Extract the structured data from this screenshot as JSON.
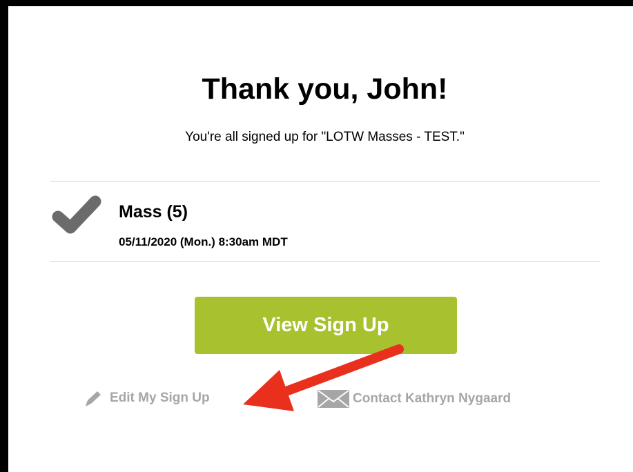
{
  "confirmation": {
    "title": "Thank you, John!",
    "subtitle": "You're all signed up for \"LOTW Masses - TEST.\""
  },
  "slot": {
    "title": "Mass (5)",
    "datetime": "05/11/2020 (Mon.) 8:30am MDT",
    "status_icon": "checkmark-icon"
  },
  "actions": {
    "view_label": "View Sign Up",
    "edit_label": "Edit My Sign Up",
    "contact_label": "Contact Kathryn Nygaard"
  },
  "colors": {
    "button": "#a7c12f",
    "link_gray": "#a6a6a6",
    "check_gray": "#6b6b6b",
    "annotation_arrow": "#e8301c"
  },
  "annotation": {
    "type": "arrow",
    "points_to": "edit-link"
  }
}
